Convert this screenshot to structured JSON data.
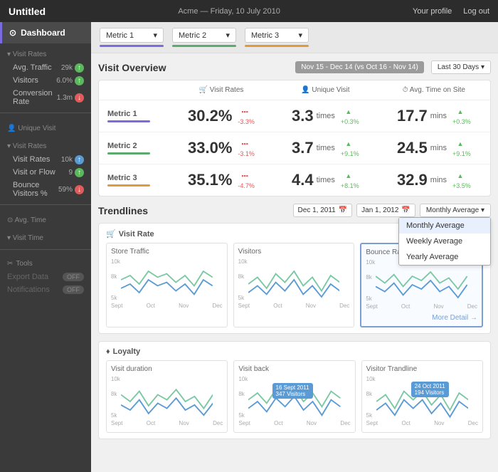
{
  "topbar": {
    "title": "Untitled",
    "subtitle": "Acme — Friday, 10 July 2010",
    "profile_label": "Your profile",
    "logout_label": "Log out"
  },
  "sidebar": {
    "dashboard_label": "Dashboard",
    "sections": [
      {
        "label": "Visit Rates",
        "type": "section",
        "items": [
          {
            "label": "Avg. Traffic",
            "value": "29k",
            "badge": "green"
          },
          {
            "label": "Visitors",
            "value": "6.0%",
            "badge": "green"
          },
          {
            "label": "Conversion Rate",
            "value": "1.3m",
            "badge": "red"
          }
        ]
      },
      {
        "label": "Unique Visit",
        "type": "section",
        "items": [
          {
            "label": "Visit Rates",
            "value": "10k",
            "badge": "blue"
          },
          {
            "label": "Visit or Flow",
            "value": "9",
            "badge": "green"
          },
          {
            "label": "Bounce Visitors %",
            "value": "59%",
            "badge": "red"
          }
        ]
      },
      {
        "label": "Avg. Time",
        "type": "section",
        "items": [
          {
            "label": "Visit Time",
            "value": "",
            "badge": ""
          }
        ]
      }
    ],
    "tools_label": "Tools",
    "tools": [
      {
        "label": "Export Data",
        "toggle": "OFF"
      },
      {
        "label": "Notifications",
        "toggle": "OFF"
      }
    ]
  },
  "metrics": [
    {
      "label": "Metric 1",
      "color": "purple"
    },
    {
      "label": "Metric 2",
      "color": "green"
    },
    {
      "label": "Metric 3",
      "color": "orange"
    }
  ],
  "visit_overview": {
    "title": "Visit Overview",
    "date_range_btn": "Nov 15 - Dec 14 (vs Oct 16 - Nov 14)",
    "date_range_select": "Last 30 Days",
    "columns": [
      {
        "icon": "cart",
        "label": "Visit Rates"
      },
      {
        "icon": "person",
        "label": "Unique Visit"
      },
      {
        "icon": "clock",
        "label": "Avg. Time on Site"
      }
    ],
    "rows": [
      {
        "metric": "Metric 1",
        "color": "purple",
        "visit_rate": "30.2%",
        "visit_rate_change": "-3.3%",
        "visit_rate_dir": "neg",
        "unique_visit": "3.3",
        "unique_visit_unit": "times",
        "unique_visit_change": "+0.3%",
        "unique_visit_dir": "pos",
        "avg_time": "17.7",
        "avg_time_unit": "mins",
        "avg_time_change": "+0.3%",
        "avg_time_dir": "pos"
      },
      {
        "metric": "Metric 2",
        "color": "green",
        "visit_rate": "33.0%",
        "visit_rate_change": "-3.1%",
        "visit_rate_dir": "neg",
        "unique_visit": "3.7",
        "unique_visit_unit": "times",
        "unique_visit_change": "+9.1%",
        "unique_visit_dir": "pos",
        "avg_time": "24.5",
        "avg_time_unit": "mins",
        "avg_time_change": "+9.1%",
        "avg_time_dir": "pos"
      },
      {
        "metric": "Metric 3",
        "color": "orange",
        "visit_rate": "35.1%",
        "visit_rate_change": "-4.7%",
        "visit_rate_dir": "neg",
        "unique_visit": "4.4",
        "unique_visit_unit": "times",
        "unique_visit_change": "+8.1%",
        "unique_visit_dir": "pos",
        "avg_time": "32.9",
        "avg_time_unit": "mins",
        "avg_time_change": "+3.5%",
        "avg_time_dir": "pos"
      }
    ]
  },
  "trendlines": {
    "title": "Trendlines",
    "date_from": "Dec 1, 2011",
    "date_to": "Jan 1, 2012",
    "period_select": "Monthly Average",
    "period_options": [
      "Monthly Average",
      "Weekly Average",
      "Yearly Average"
    ],
    "sections": [
      {
        "label": "Visit Rate",
        "charts": [
          {
            "title": "Store Traffic",
            "y_max": "10k",
            "y_mid": "8k",
            "y_min": "5k",
            "active": false,
            "x_labels": [
              "Sept",
              "Oct",
              "Nov",
              "Dec"
            ]
          },
          {
            "title": "Visitors",
            "y_max": "10k",
            "y_mid": "8k",
            "y_min": "5k",
            "active": false,
            "x_labels": [
              "Sept",
              "Oct",
              "Nov",
              "Dec"
            ]
          },
          {
            "title": "Bounce Rate",
            "y_max": "10k",
            "y_mid": "8k",
            "y_min": "5k",
            "active": true,
            "x_labels": [
              "Sept",
              "Oct",
              "Nov",
              "Dec"
            ]
          }
        ],
        "more_detail": "More Detail →"
      },
      {
        "label": "Loyalty",
        "charts": [
          {
            "title": "Visit duration",
            "y_max": "10k",
            "y_mid": "8k",
            "y_min": "5k",
            "active": false,
            "x_labels": [
              "Sept",
              "Oct",
              "Nov",
              "Dec"
            ],
            "tooltip": null
          },
          {
            "title": "Visit back",
            "y_max": "10k",
            "y_mid": "8k",
            "y_min": "5k",
            "active": false,
            "x_labels": [
              "Sept",
              "Oct",
              "Nov",
              "Dec"
            ],
            "tooltip": "16 Sept 2011\n347 Visitors"
          },
          {
            "title": "Visitor Trandline",
            "y_max": "10k",
            "y_mid": "8k",
            "y_min": "5k",
            "active": false,
            "x_labels": [
              "Sept",
              "Oct",
              "Nov",
              "Dec"
            ],
            "tooltip": "24 Oct 2011\n194 Visitors"
          }
        ]
      }
    ]
  }
}
